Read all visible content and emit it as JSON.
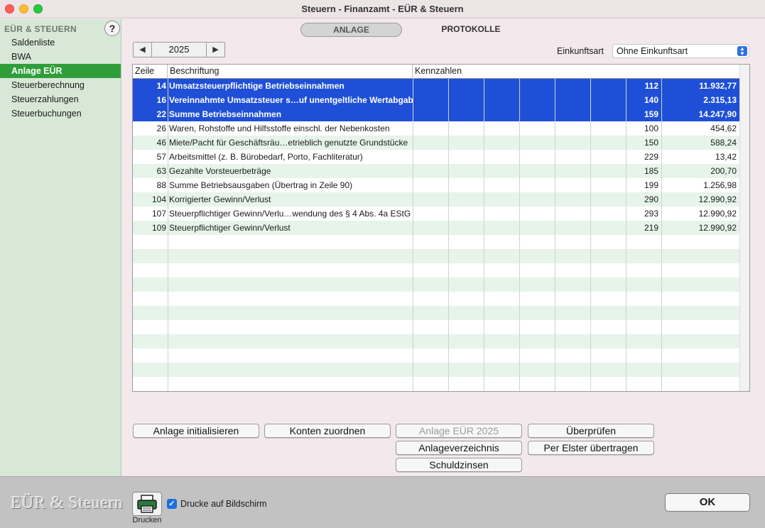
{
  "window": {
    "title": "Steuern - Finanzamt - EÜR & Steuern"
  },
  "sidebar": {
    "header": "EÜR & STEUERN",
    "help": "?",
    "items": [
      {
        "label": "Saldenliste",
        "active": false
      },
      {
        "label": "BWA",
        "active": false
      },
      {
        "label": "Anlage EÜR",
        "active": true
      },
      {
        "label": "Steuerberechnung",
        "active": false
      },
      {
        "label": "Steuerzahlungen",
        "active": false
      },
      {
        "label": "Steuerbuchungen",
        "active": false
      }
    ]
  },
  "tabs": [
    {
      "label": "ANLAGE",
      "active": true
    },
    {
      "label": "PROTOKOLLE",
      "active": false
    }
  ],
  "year_stepper": {
    "prev": "◀",
    "year": "2025",
    "next": "▶"
  },
  "einkunftsart": {
    "label": "Einkunftsart",
    "value": "Ohne Einkunftsart"
  },
  "table": {
    "headers": {
      "zeile": "Zeile",
      "beschriftung": "Beschriftung",
      "kennzahlen": "Kennzahlen"
    },
    "rows": [
      {
        "zeile": "14",
        "beschriftung": "Umsatzsteuerpflichtige Betriebseinnahmen",
        "kz": "112",
        "wert": "11.932,77",
        "selected": true
      },
      {
        "zeile": "16",
        "beschriftung": "Vereinnahmte Umsatzsteuer s…uf unentgeltliche Wertabgaben",
        "kz": "140",
        "wert": "2.315,13",
        "selected": true
      },
      {
        "zeile": "22",
        "beschriftung": "Summe Betriebseinnahmen",
        "kz": "159",
        "wert": "14.247,90",
        "selected": true
      },
      {
        "zeile": "26",
        "beschriftung": "Waren,  Rohstoffe und Hilfsstoffe einschl. der Nebenkosten",
        "kz": "100",
        "wert": "454,62",
        "selected": false
      },
      {
        "zeile": "46",
        "beschriftung": "Miete/Pacht für Geschäftsräu…etrieblich genutzte Grundstücke",
        "kz": "150",
        "wert": "588,24",
        "selected": false
      },
      {
        "zeile": "57",
        "beschriftung": "Arbeitsmittel (z. B. Bürobedarf, Porto, Fachliteratur)",
        "kz": "229",
        "wert": "13,42",
        "selected": false
      },
      {
        "zeile": "63",
        "beschriftung": "Gezahlte Vorsteuerbeträge",
        "kz": "185",
        "wert": "200,70",
        "selected": false
      },
      {
        "zeile": "88",
        "beschriftung": "Summe Betriebsausgaben (Übertrag in Zeile 90)",
        "kz": "199",
        "wert": "1.256,98",
        "selected": false
      },
      {
        "zeile": "104",
        "beschriftung": "Korrigierter Gewinn/Verlust",
        "kz": "290",
        "wert": "12.990,92",
        "selected": false
      },
      {
        "zeile": "107",
        "beschriftung": "Steuerpflichtiger Gewinn/Verlu…wendung des § 4 Abs. 4a EStG",
        "kz": "293",
        "wert": "12.990,92",
        "selected": false
      },
      {
        "zeile": "109",
        "beschriftung": "Steuerpflichtiger Gewinn/Verlust",
        "kz": "219",
        "wert": "12.990,92",
        "selected": false
      }
    ]
  },
  "buttons": {
    "anlage_initialisieren": "Anlage initialisieren",
    "konten_zuordnen": "Konten zuordnen",
    "anlage_eur_2025": "Anlage EÜR 2025",
    "ueberpruefen": "Überprüfen",
    "anlageverzeichnis": "Anlageverzeichnis",
    "per_elster": "Per Elster übertragen",
    "schuldzinsen": "Schuldzinsen"
  },
  "footer": {
    "logo": "EÜR & Steuern",
    "print_label": "Drucken",
    "checkbox_label": "Drucke auf Bildschirm",
    "checkbox_checked": true,
    "ok": "OK"
  }
}
